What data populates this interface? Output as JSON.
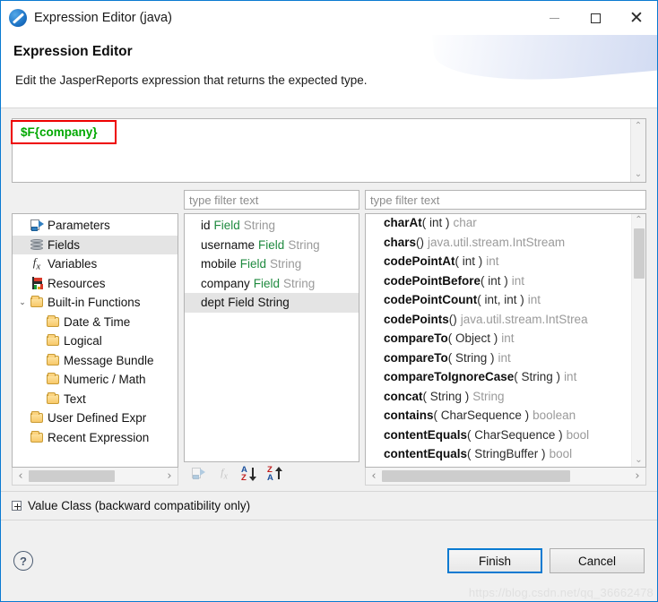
{
  "window": {
    "title": "Expression Editor (java)",
    "app_icon": "jaspersoft-logo-icon",
    "minimize_label": "–",
    "maximize_label": "□",
    "close_label": "✕",
    "border_color": "#0a7ad1"
  },
  "header": {
    "title": "Expression Editor",
    "description": "Edit the JasperReports expression that returns the expected type."
  },
  "expression": {
    "value": "$F{company}",
    "text_color": "#00a800",
    "annotation_color": "#ee0000",
    "scroll_up": "⌃",
    "scroll_down": "⌄"
  },
  "tree": {
    "items": [
      {
        "label": "Parameters",
        "icon": "parameters-icon",
        "indent": 1,
        "twisty": "",
        "selected": false
      },
      {
        "label": "Fields",
        "icon": "fields-db-icon",
        "indent": 1,
        "twisty": "",
        "selected": true
      },
      {
        "label": "Variables",
        "icon": "fx-icon",
        "indent": 1,
        "twisty": "",
        "selected": false
      },
      {
        "label": "Resources",
        "icon": "resources-flag-icon",
        "indent": 1,
        "twisty": "",
        "selected": false
      },
      {
        "label": "Built-in Functions",
        "icon": "folder-icon",
        "indent": 0,
        "twisty": "⌄",
        "selected": false
      },
      {
        "label": "Date & Time",
        "icon": "folder-icon",
        "indent": 2,
        "twisty": "",
        "selected": false
      },
      {
        "label": "Logical",
        "icon": "folder-icon",
        "indent": 2,
        "twisty": "",
        "selected": false
      },
      {
        "label": "Message Bundle",
        "icon": "folder-icon",
        "indent": 2,
        "twisty": "",
        "selected": false
      },
      {
        "label": "Numeric / Math",
        "icon": "folder-icon",
        "indent": 2,
        "twisty": "",
        "selected": false
      },
      {
        "label": "Text",
        "icon": "folder-icon",
        "indent": 2,
        "twisty": "",
        "selected": false
      },
      {
        "label": "User Defined Expr",
        "icon": "folder-icon",
        "indent": 1,
        "twisty": "",
        "selected": false
      },
      {
        "label": "Recent Expression",
        "icon": "folder-icon",
        "indent": 1,
        "twisty": "",
        "selected": false
      }
    ],
    "hscroll": {
      "left_arrow": "‹",
      "right_arrow": "›"
    }
  },
  "fields_panel": {
    "filter_placeholder": "type filter text",
    "filter_value": "",
    "items": [
      {
        "name": "id",
        "kind": "Field",
        "type": "String",
        "selected": false
      },
      {
        "name": "username",
        "kind": "Field",
        "type": "String",
        "selected": false
      },
      {
        "name": "mobile",
        "kind": "Field",
        "type": "String",
        "selected": false
      },
      {
        "name": "company",
        "kind": "Field",
        "type": "String",
        "selected": false
      },
      {
        "name": "dept",
        "kind": "Field",
        "type": "String",
        "selected": true
      }
    ],
    "toolbar": [
      {
        "icon": "insert-parameter-icon",
        "enabled": false
      },
      {
        "icon": "insert-function-icon",
        "enabled": false
      },
      {
        "icon": "sort-az-descending-icon",
        "enabled": true,
        "top": "A",
        "bottom": "Z",
        "direction": "down"
      },
      {
        "icon": "sort-za-ascending-icon",
        "enabled": true,
        "top": "Z",
        "bottom": "A",
        "direction": "up"
      }
    ]
  },
  "methods_panel": {
    "filter_placeholder": "type filter text",
    "filter_value": "",
    "items": [
      {
        "name": "charAt",
        "args": "( int )",
        "ret": "char"
      },
      {
        "name": "chars",
        "args": "()",
        "ret": "java.util.stream.IntStream"
      },
      {
        "name": "codePointAt",
        "args": "( int )",
        "ret": "int"
      },
      {
        "name": "codePointBefore",
        "args": "( int )",
        "ret": "int"
      },
      {
        "name": "codePointCount",
        "args": "( int, int )",
        "ret": "int"
      },
      {
        "name": "codePoints",
        "args": "()",
        "ret": "java.util.stream.IntStrea"
      },
      {
        "name": "compareTo",
        "args": "( Object )",
        "ret": "int"
      },
      {
        "name": "compareTo",
        "args": "( String )",
        "ret": "int"
      },
      {
        "name": "compareToIgnoreCase",
        "args": "( String )",
        "ret": "int"
      },
      {
        "name": "concat",
        "args": "( String )",
        "ret": "String"
      },
      {
        "name": "contains",
        "args": "( CharSequence )",
        "ret": "boolean"
      },
      {
        "name": "contentEquals",
        "args": "( CharSequence )",
        "ret": "bool"
      },
      {
        "name": "contentEquals",
        "args": "( StringBuffer )",
        "ret": "bool"
      }
    ],
    "hscroll": {
      "left_arrow": "‹",
      "right_arrow": "›"
    },
    "vscroll": {
      "up_arrow": "⌃",
      "down_arrow": "⌄"
    }
  },
  "value_class": {
    "label": "Value Class (backward compatibility only)",
    "expanded": false
  },
  "footer": {
    "help_label": "?",
    "finish_label": "Finish",
    "cancel_label": "Cancel",
    "focus_color": "#0a7ad1",
    "watermark": "https://blog.csdn.net/qq_36662478"
  }
}
